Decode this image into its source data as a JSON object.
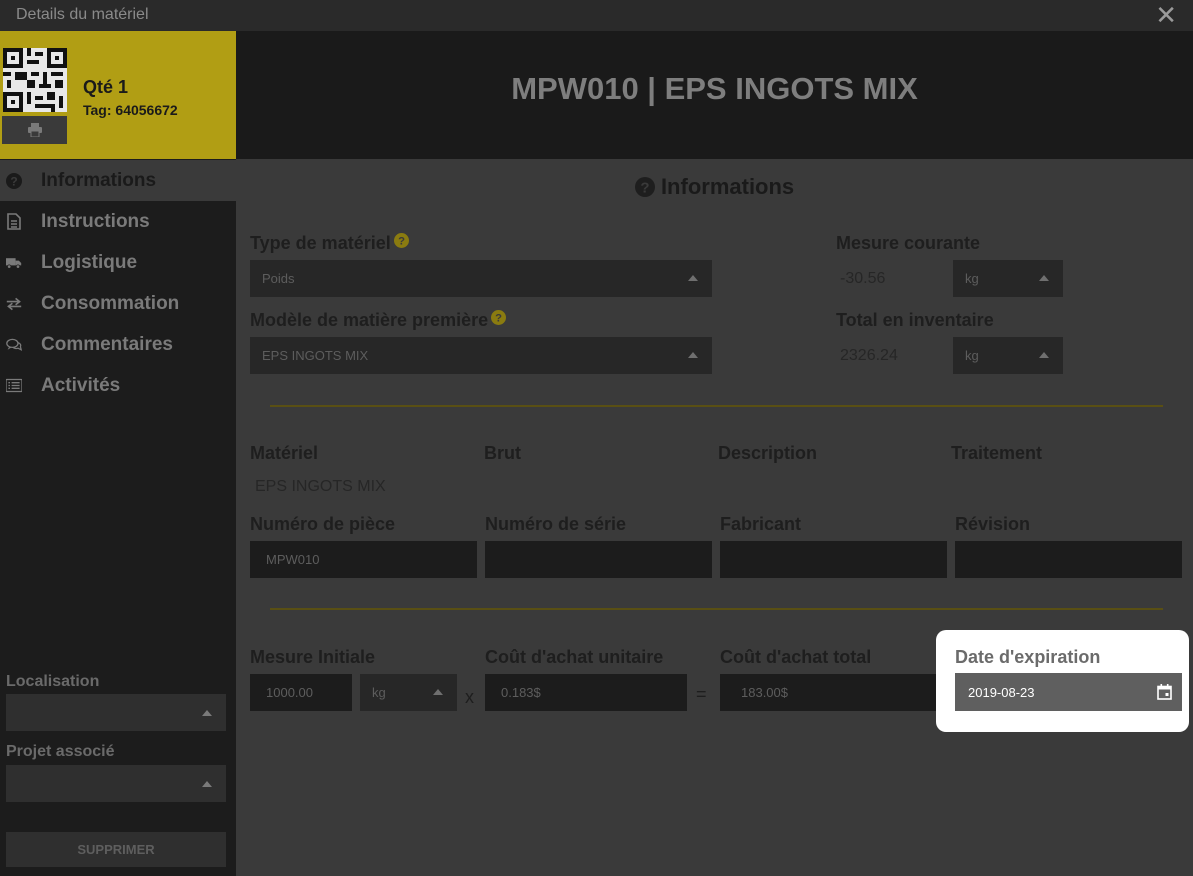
{
  "window": {
    "title": "Details du matériel",
    "close_glyph": "✕"
  },
  "tag_card": {
    "qty": "Qté 1",
    "tag": "Tag: 64056672"
  },
  "header": {
    "title": "MPW010 | EPS INGOTS MIX"
  },
  "nav": [
    {
      "label": "Informations",
      "icon": "question-circle-icon",
      "active": true
    },
    {
      "label": "Instructions",
      "icon": "document-icon"
    },
    {
      "label": "Logistique",
      "icon": "truck-icon"
    },
    {
      "label": "Consommation",
      "icon": "exchange-arrows-icon"
    },
    {
      "label": "Commentaires",
      "icon": "comments-icon"
    },
    {
      "label": "Activités",
      "icon": "list-icon"
    }
  ],
  "sidebar": {
    "location_label": "Localisation",
    "project_label": "Projet associé",
    "delete_label": "SUPPRIMER"
  },
  "section": {
    "title": "Informations"
  },
  "form": {
    "material_type_label": "Type de matériel",
    "material_type_value": "Poids",
    "raw_model_label": "Modèle de matière première",
    "raw_model_value": "EPS INGOTS MIX",
    "current_measure_label": "Mesure courante",
    "current_measure_value": "-30.56",
    "current_measure_unit": "kg",
    "inventory_total_label": "Total en inventaire",
    "inventory_total_value": "2326.24",
    "inventory_total_unit": "kg",
    "material_label": "Matériel",
    "material_value": "EPS INGOTS MIX",
    "raw_label": "Brut",
    "description_label": "Description",
    "treatment_label": "Traitement",
    "part_number_label": "Numéro de pièce",
    "part_number_value": "MPW010",
    "serial_label": "Numéro de série",
    "serial_value": "",
    "manufacturer_label": "Fabricant",
    "manufacturer_value": "",
    "revision_label": "Révision",
    "revision_value": "",
    "initial_measure_label": "Mesure Initiale",
    "initial_measure_value": "1000.00",
    "initial_measure_unit": "kg",
    "times_symbol": "x",
    "unit_cost_label": "Coût d'achat unitaire",
    "unit_cost_value": "0.183$",
    "equals_symbol": "=",
    "total_cost_label": "Coût d'achat total",
    "total_cost_value": "183.00$",
    "expiry_label": "Date d'expiration",
    "expiry_value": "2019-08-23"
  },
  "colors": {
    "accent": "#b19e14",
    "overlay_bg": "#3a3a3a",
    "highlight_bg": "#ffffff"
  }
}
